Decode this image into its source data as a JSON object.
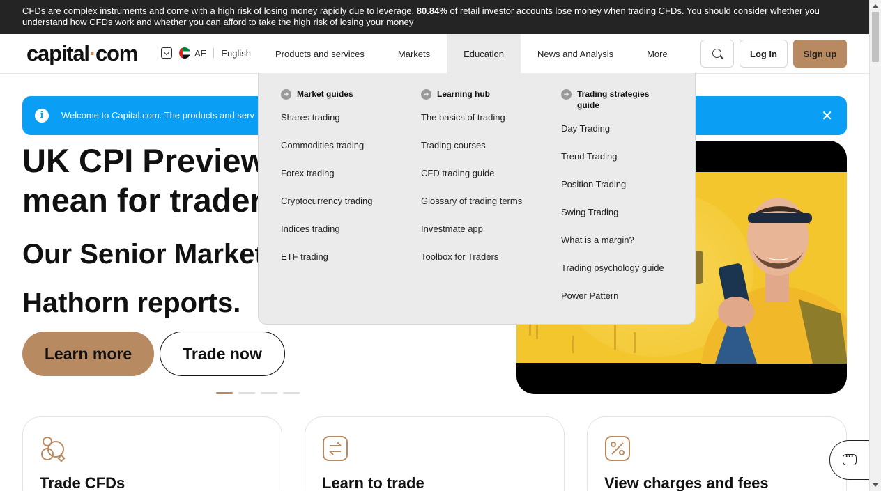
{
  "risk_banner": {
    "text_before": "CFDs are complex instruments and come with a high risk of losing money rapidly due to leverage.",
    "percent": "80.84%",
    "text_after": "of retail investor accounts lose money when trading CFDs. You should consider whether you understand how CFDs work and whether you can afford to take the high risk of losing your money"
  },
  "header": {
    "logo_main": "capital",
    "logo_dot": "·",
    "logo_tld": "com",
    "region": "AE",
    "language": "English",
    "nav": [
      {
        "label": "Products and services"
      },
      {
        "label": "Markets"
      },
      {
        "label": "Education"
      },
      {
        "label": "News and Analysis"
      },
      {
        "label": "More"
      }
    ],
    "login_label": "Log In",
    "signup_label": "Sign up"
  },
  "welcome": {
    "message": "Welcome to Capital.com. The products and serv",
    "close": "✕",
    "info": "i"
  },
  "hero": {
    "title_line1": "UK CPI Preview:",
    "title_line2": "mean for trader",
    "sub_line1": "Our Senior Market",
    "sub_line2": "Hathorn reports.",
    "learn_more": "Learn more",
    "trade_now": "Trade now"
  },
  "education_menu": {
    "columns": [
      {
        "heading": "Market guides",
        "items": [
          "Shares trading",
          "Commodities trading",
          "Forex trading",
          "Cryptocurrency trading",
          "Indices trading",
          "ETF trading"
        ]
      },
      {
        "heading": "Learning hub",
        "items": [
          "The basics of trading",
          "Trading courses",
          "CFD trading guide",
          "Glossary of trading terms",
          "Investmate app",
          "Toolbox for Traders"
        ]
      },
      {
        "heading": "Trading strategies guide",
        "items": [
          "Day Trading",
          "Trend Trading",
          "Position Trading",
          "Swing Trading",
          "What is a margin?",
          "Trading psychology guide",
          "Power Pattern"
        ]
      }
    ]
  },
  "cards": [
    {
      "title": "Trade CFDs"
    },
    {
      "title": "Learn to trade"
    },
    {
      "title": "View charges and fees"
    }
  ],
  "colors": {
    "accent": "#b88a62",
    "info_blue": "#0a9ef5",
    "banner_dark": "#242424"
  }
}
